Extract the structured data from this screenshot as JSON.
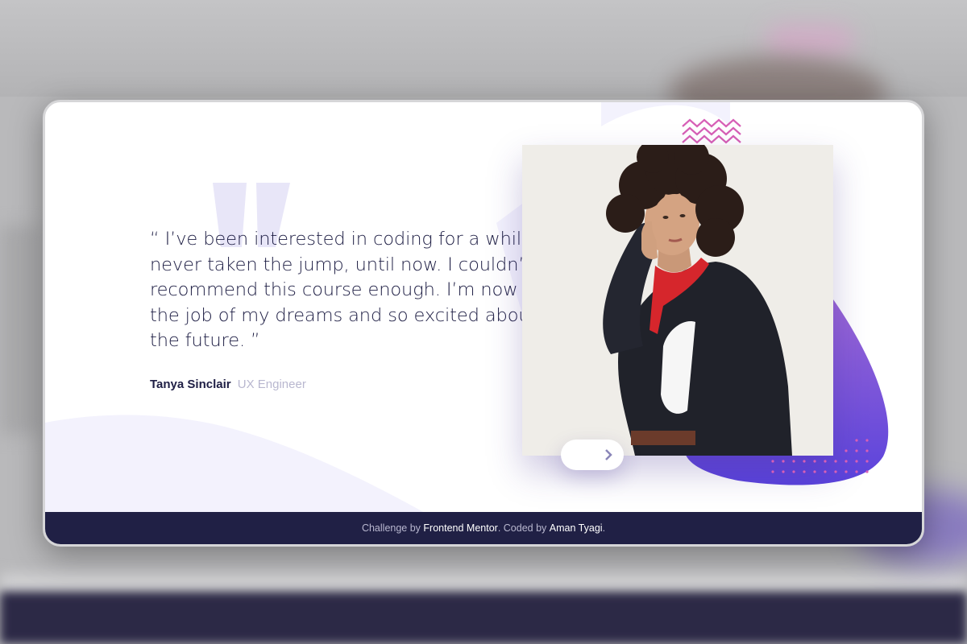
{
  "testimonial": {
    "quote": "“ I’ve been interested in coding for a while but never taken the jump, until now. I couldn’t recommend this course enough. I’m now in the job of my dreams and so excited about the future. ”",
    "author_name": "Tanya Sinclair",
    "author_role": "UX Engineer"
  },
  "photo": {
    "alt": "Tanya Sinclair"
  },
  "controls": {
    "prev_icon": "chevron-left-icon",
    "next_icon": "chevron-right-icon"
  },
  "footer": {
    "challenge_prefix": "Challenge by",
    "challenge_link": "Frontend Mentor",
    "coded_prefix": ". Coded by",
    "coded_link": "Aman Tyagi",
    "suffix": "."
  },
  "colors": {
    "dark_blue": "#202045",
    "grayish_blue": "#b8b7cf",
    "pale_purple": "#f3f2fd",
    "accent_purple": "#6b50e0",
    "accent_pink": "#d75fb6"
  }
}
